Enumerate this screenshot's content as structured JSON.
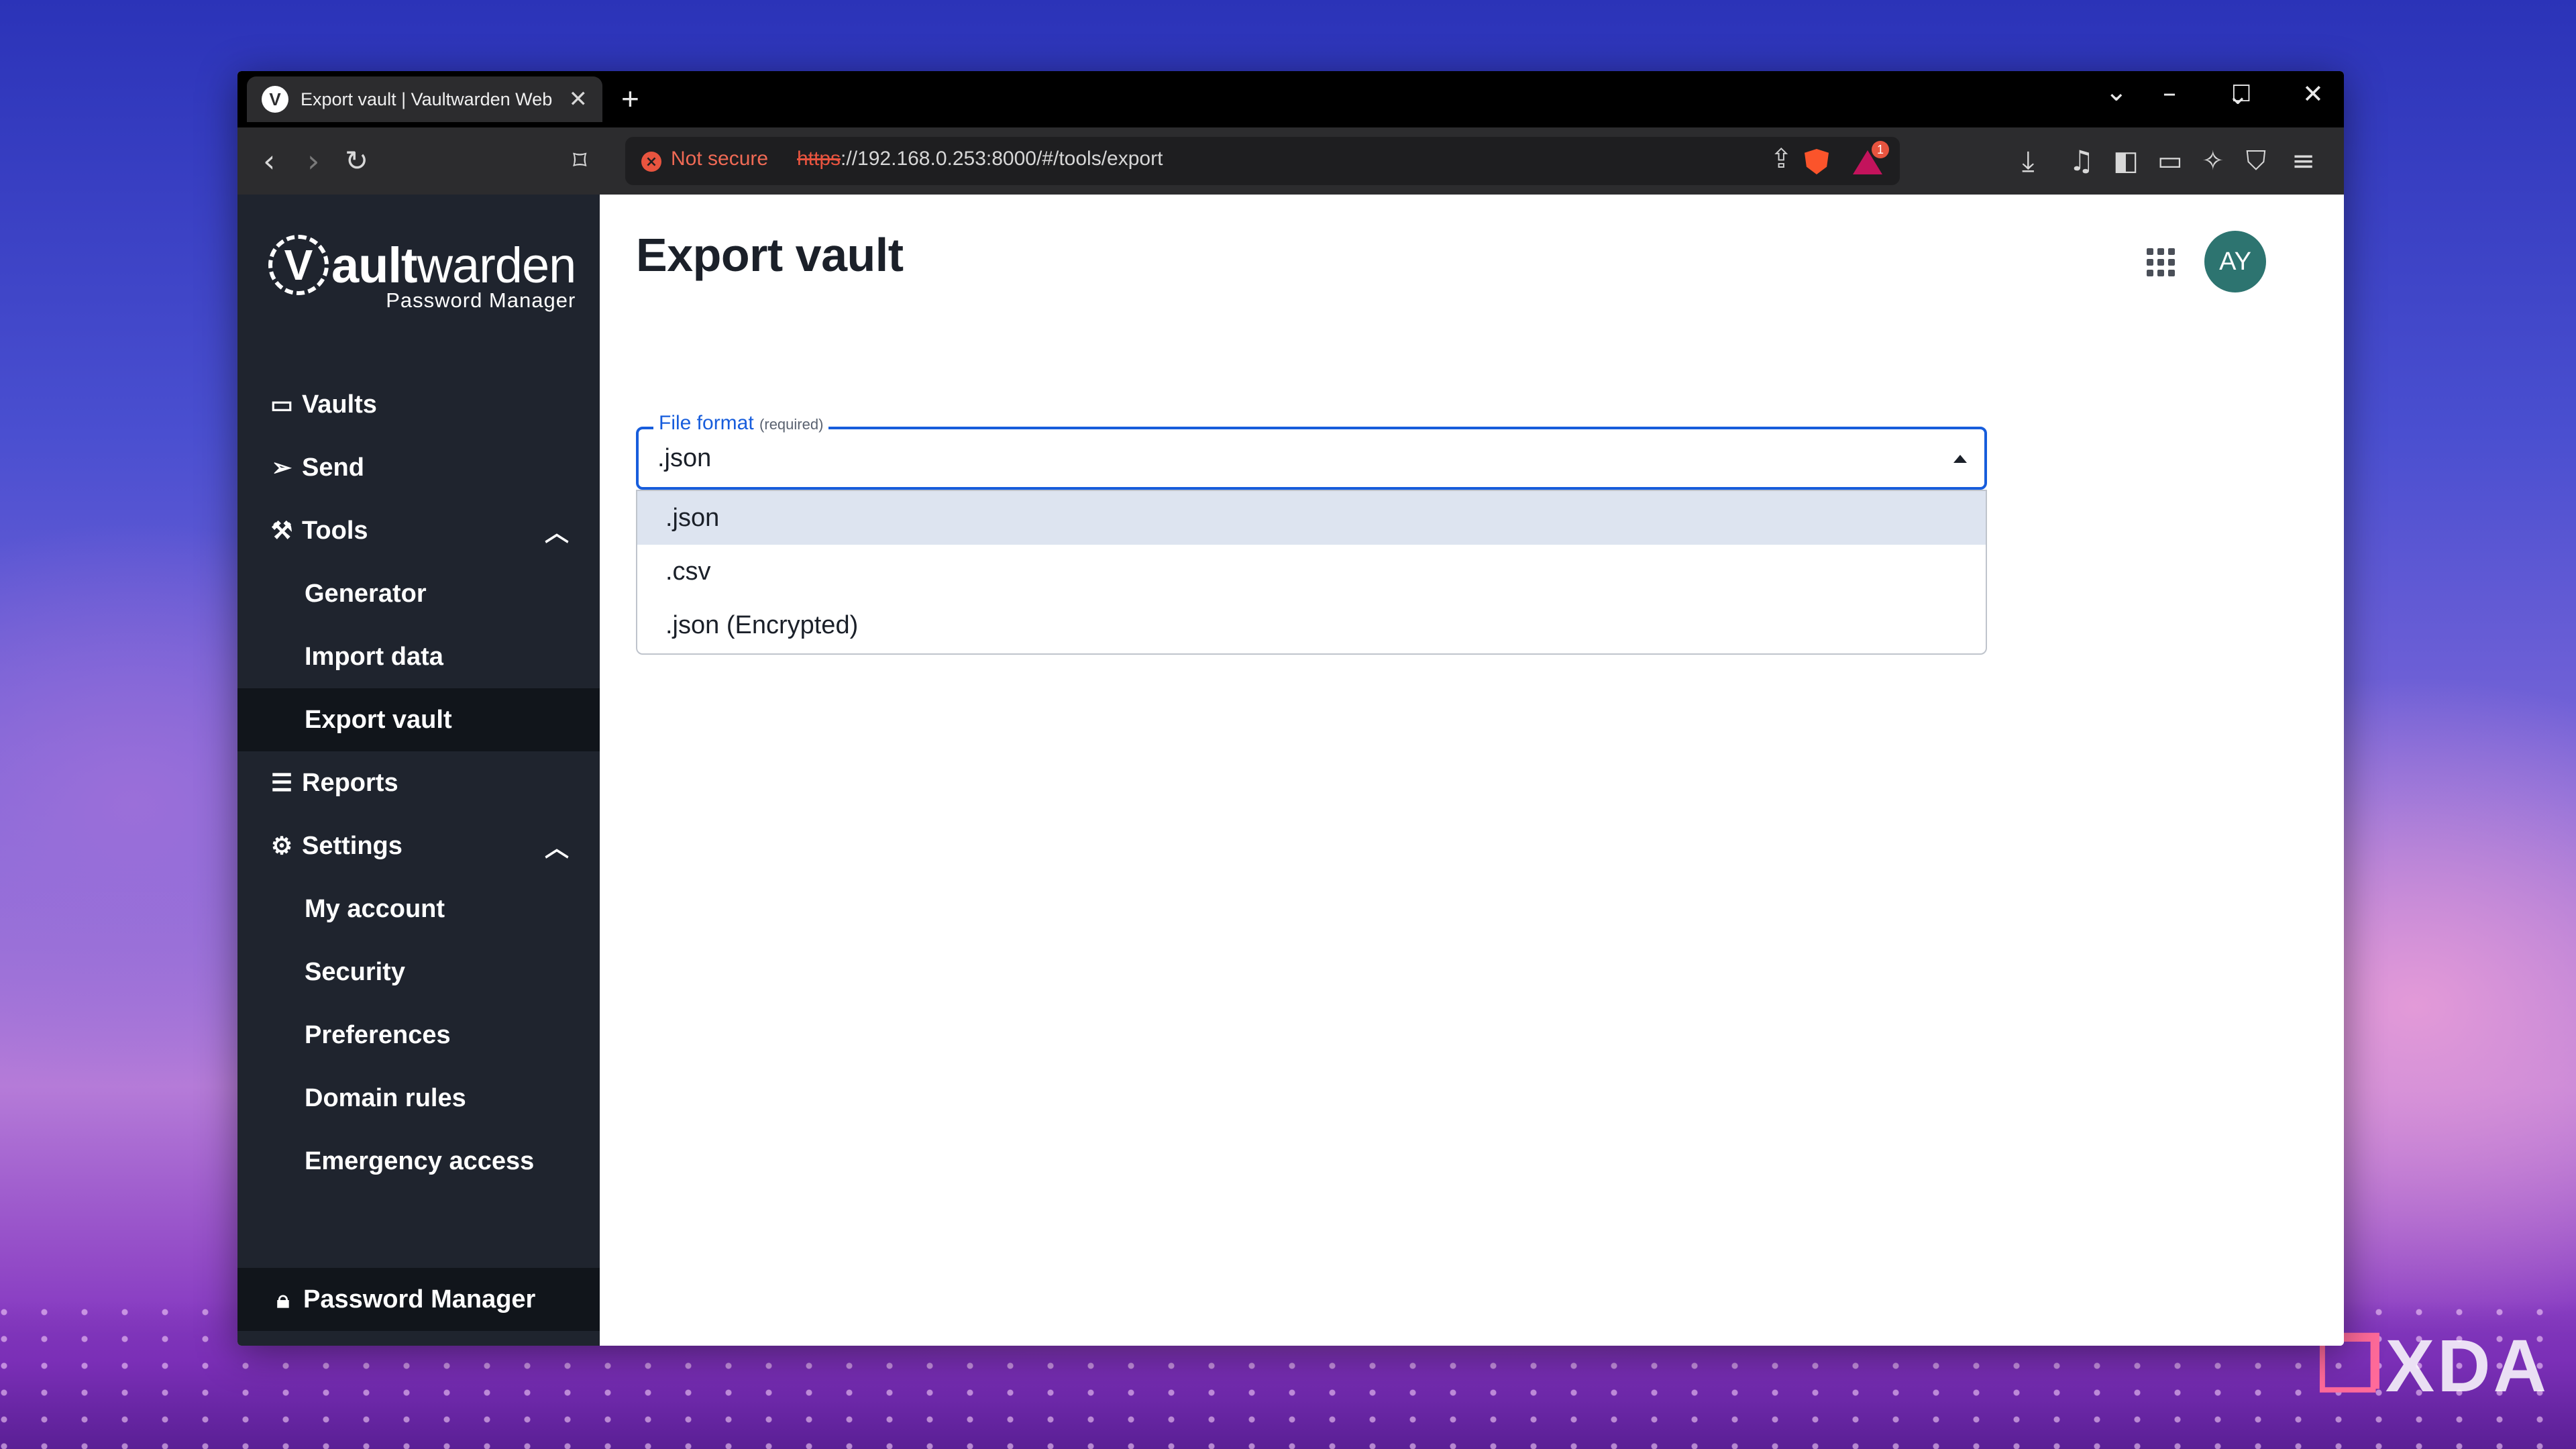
{
  "browser": {
    "tab_title": "Export vault | Vaultwarden Web",
    "tab_favicon_letter": "V",
    "new_tab": "+",
    "security_label": "Not secure",
    "url_scheme": "https",
    "url_rest": "://192.168.0.253:8000/#/tools/export",
    "rewards_badge": "1"
  },
  "brand": {
    "logo_letter": "V",
    "name_bold": "ault",
    "name_rest": "warden",
    "subtitle": "Password Manager"
  },
  "sidebar": {
    "items": [
      {
        "label": "Vaults",
        "icon": "vault-icon"
      },
      {
        "label": "Send",
        "icon": "paper-plane-icon"
      },
      {
        "label": "Tools",
        "icon": "wrench-icon"
      },
      {
        "label": "Generator"
      },
      {
        "label": "Import data"
      },
      {
        "label": "Export vault"
      },
      {
        "label": "Reports",
        "icon": "sliders-icon"
      },
      {
        "label": "Settings",
        "icon": "gear-icon"
      },
      {
        "label": "My account"
      },
      {
        "label": "Security"
      },
      {
        "label": "Preferences"
      },
      {
        "label": "Domain rules"
      },
      {
        "label": "Emergency access"
      }
    ],
    "footer_label": "Password Manager"
  },
  "main": {
    "title": "Export vault",
    "avatar_initials": "AY",
    "file_format": {
      "label": "File format",
      "required": "(required)",
      "value": ".json",
      "options": [
        ".json",
        ".csv",
        ".json (Encrypted)"
      ]
    }
  },
  "watermark": {
    "text": "XDA"
  },
  "colors": {
    "accent": "#175ddc",
    "sidebar_bg": "#1f242e",
    "avatar_bg": "#2d7470",
    "not_secure": "#e8543f"
  }
}
